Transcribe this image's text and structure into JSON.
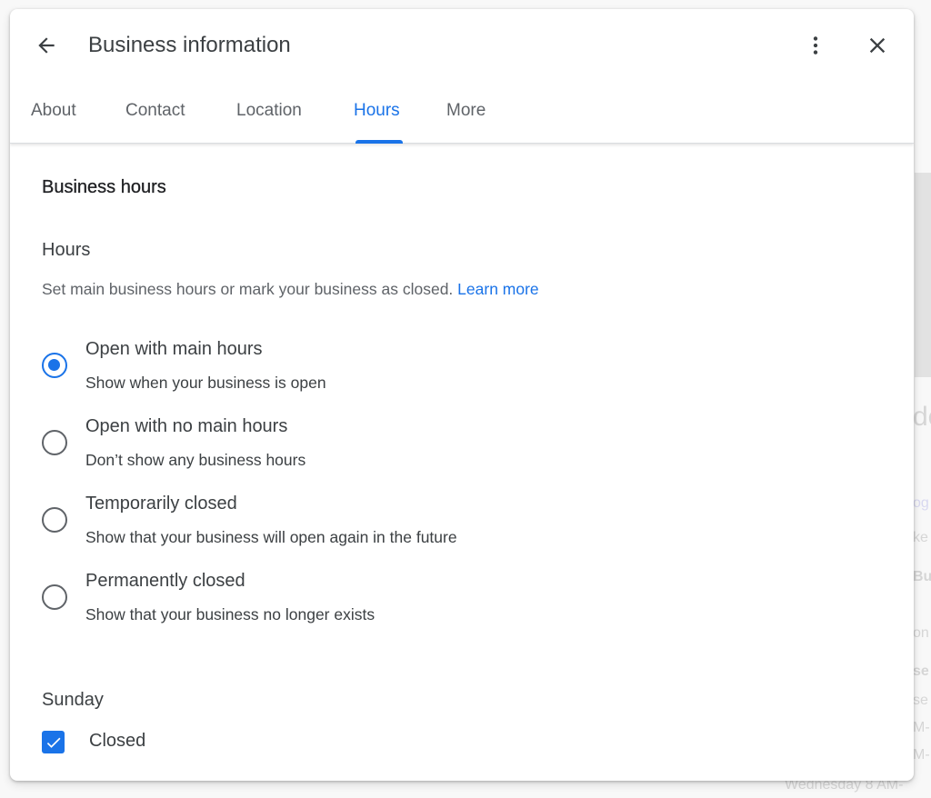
{
  "dialog": {
    "title": "Business information",
    "back_icon": "arrow-left-icon",
    "more_icon": "more-vert-icon",
    "close_icon": "close-icon"
  },
  "tabs": [
    {
      "label": "About",
      "active": false
    },
    {
      "label": "Contact",
      "active": false
    },
    {
      "label": "Location",
      "active": false
    },
    {
      "label": "Hours",
      "active": true
    },
    {
      "label": "More",
      "active": false
    }
  ],
  "section": {
    "title": "Business hours",
    "subtitle": "Hours",
    "helper_text": "Set main business hours or mark your business as closed.",
    "learn_more": "Learn more"
  },
  "options": [
    {
      "label": "Open with main hours",
      "description": "Show when your business is open",
      "selected": true
    },
    {
      "label": "Open with no main hours",
      "description": "Don’t show any business hours",
      "selected": false
    },
    {
      "label": "Temporarily closed",
      "description": "Show that your business will open again in the future",
      "selected": false
    },
    {
      "label": "Permanently closed",
      "description": "Show that your business no longer exists",
      "selected": false
    }
  ],
  "day": {
    "name": "Sunday",
    "closed_label": "Closed",
    "closed_checked": true
  },
  "background": {
    "fragments": [
      "de",
      "og",
      "ke",
      "Bus",
      "on",
      "se",
      "se",
      "M-",
      "M-",
      "Wednesday  8 AM-"
    ]
  },
  "colors": {
    "accent": "#1a73e8",
    "text_primary": "#202124",
    "text_secondary": "#3c4043",
    "text_muted": "#5f6368"
  }
}
